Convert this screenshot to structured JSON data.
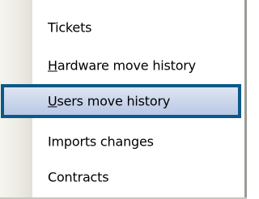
{
  "menu": {
    "items": [
      {
        "label": "Tickets",
        "accel": "",
        "rest": "Tickets",
        "selected": false
      },
      {
        "label": "Hardware move history",
        "accel": "H",
        "rest": "ardware move history",
        "selected": false
      },
      {
        "label": "Users move history",
        "accel": "U",
        "rest": "sers move history",
        "selected": true
      },
      {
        "label": "Imports changes",
        "accel": "",
        "rest": "Imports changes",
        "selected": false
      },
      {
        "label": "Contracts",
        "accel": "",
        "rest": "Contracts",
        "selected": false
      }
    ]
  },
  "colors": {
    "selection_border": "#0a5a87",
    "selection_fill": "#c9d5eb",
    "gutter": "#ecebe3"
  }
}
